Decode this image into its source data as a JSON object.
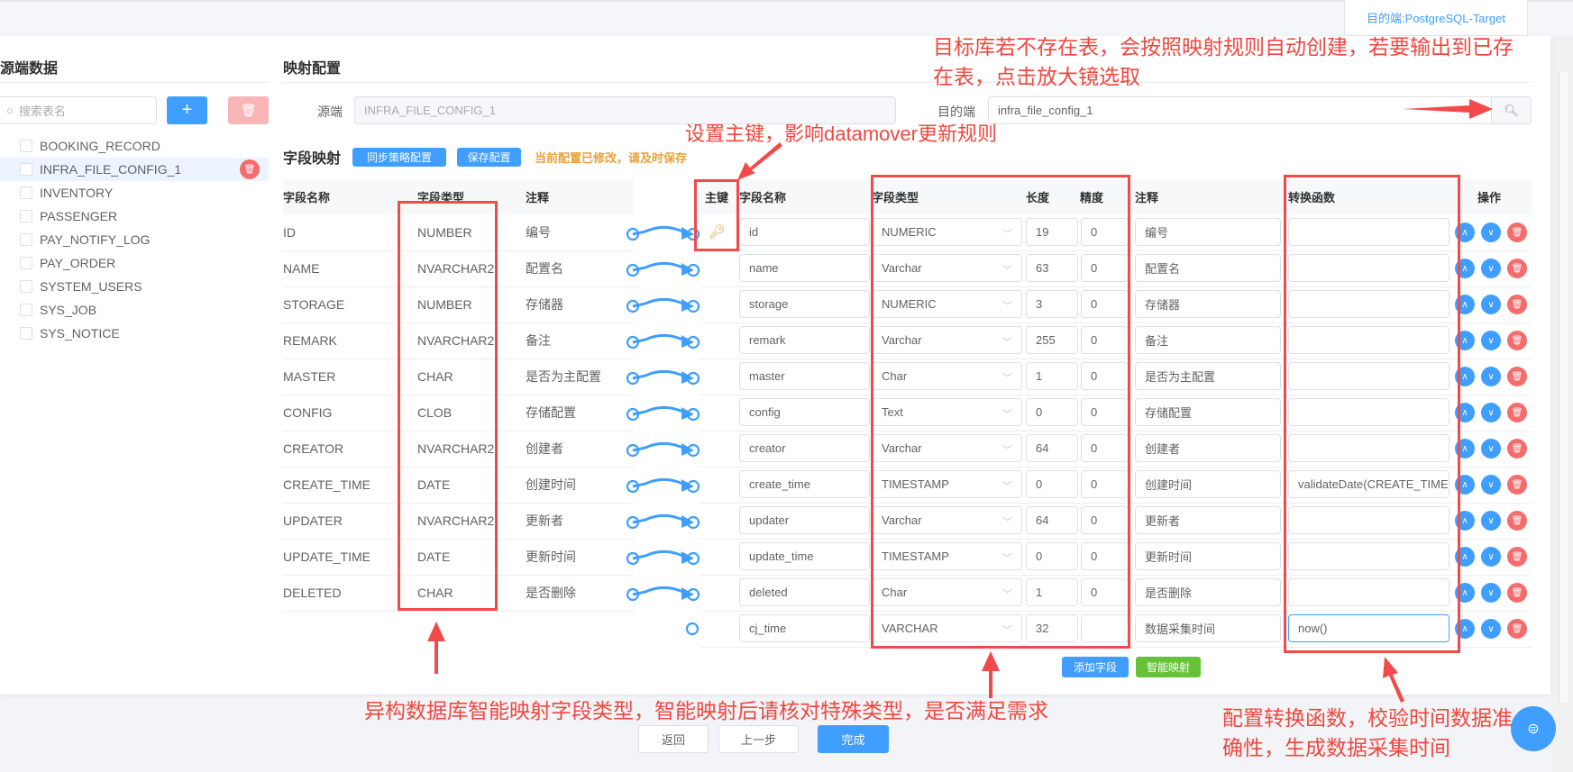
{
  "header": {
    "target_tab": "目的端:PostgreSQL-Target"
  },
  "left": {
    "title": "源端数据",
    "search_placeholder": "搜索表名",
    "add_icon": "plus-icon",
    "delete_icon": "trash-icon",
    "tables": [
      "BOOKING_RECORD",
      "INFRA_FILE_CONFIG_1",
      "INVENTORY",
      "PASSENGER",
      "PAY_NOTIFY_LOG",
      "PAY_ORDER",
      "SYSTEM_USERS",
      "SYS_JOB",
      "SYS_NOTICE"
    ],
    "selected": "INFRA_FILE_CONFIG_1"
  },
  "mapping": {
    "title": "映射配置",
    "source_label": "源端",
    "source_value": "INFRA_FILE_CONFIG_1",
    "target_label": "目的端",
    "target_value": "infra_file_config_1"
  },
  "fields": {
    "title": "字段映射",
    "sync_button": "同步策略配置",
    "save_button": "保存配置",
    "warning": "当前配置已修改，请及时保存",
    "source_headers": [
      "字段名称",
      "字段类型",
      "注释"
    ],
    "target_headers": [
      "主键",
      "字段名称",
      "字段类型",
      "长度",
      "精度",
      "注释",
      "转换函数",
      "操作"
    ],
    "source_rows": [
      [
        "ID",
        "NUMBER",
        "编号"
      ],
      [
        "NAME",
        "NVARCHAR2",
        "配置名"
      ],
      [
        "STORAGE",
        "NUMBER",
        "存储器"
      ],
      [
        "REMARK",
        "NVARCHAR2",
        "备注"
      ],
      [
        "MASTER",
        "CHAR",
        "是否为主配置"
      ],
      [
        "CONFIG",
        "CLOB",
        "存储配置"
      ],
      [
        "CREATOR",
        "NVARCHAR2",
        "创建者"
      ],
      [
        "CREATE_TIME",
        "DATE",
        "创建时间"
      ],
      [
        "UPDATER",
        "NVARCHAR2",
        "更新者"
      ],
      [
        "UPDATE_TIME",
        "DATE",
        "更新时间"
      ],
      [
        "DELETED",
        "CHAR",
        "是否删除"
      ]
    ],
    "target_rows": [
      {
        "pk": true,
        "name": "id",
        "type": "NUMERIC",
        "length": "19",
        "precision": "0",
        "comment": "编号",
        "func": ""
      },
      {
        "pk": false,
        "name": "name",
        "type": "Varchar",
        "length": "63",
        "precision": "0",
        "comment": "配置名",
        "func": ""
      },
      {
        "pk": false,
        "name": "storage",
        "type": "NUMERIC",
        "length": "3",
        "precision": "0",
        "comment": "存储器",
        "func": ""
      },
      {
        "pk": false,
        "name": "remark",
        "type": "Varchar",
        "length": "255",
        "precision": "0",
        "comment": "备注",
        "func": ""
      },
      {
        "pk": false,
        "name": "master",
        "type": "Char",
        "length": "1",
        "precision": "0",
        "comment": "是否为主配置",
        "func": ""
      },
      {
        "pk": false,
        "name": "config",
        "type": "Text",
        "length": "0",
        "precision": "0",
        "comment": "存储配置",
        "func": ""
      },
      {
        "pk": false,
        "name": "creator",
        "type": "Varchar",
        "length": "64",
        "precision": "0",
        "comment": "创建者",
        "func": ""
      },
      {
        "pk": false,
        "name": "create_time",
        "type": "TIMESTAMP",
        "length": "0",
        "precision": "0",
        "comment": "创建时间",
        "func": "validateDate(CREATE_TIME)"
      },
      {
        "pk": false,
        "name": "updater",
        "type": "Varchar",
        "length": "64",
        "precision": "0",
        "comment": "更新者",
        "func": ""
      },
      {
        "pk": false,
        "name": "update_time",
        "type": "TIMESTAMP",
        "length": "0",
        "precision": "0",
        "comment": "更新时间",
        "func": ""
      },
      {
        "pk": false,
        "name": "deleted",
        "type": "Char",
        "length": "1",
        "precision": "0",
        "comment": "是否删除",
        "func": ""
      },
      {
        "pk": false,
        "name": "cj_time",
        "type": "VARCHAR",
        "length": "32",
        "precision": "",
        "comment": "数据采集时间",
        "func": "now()"
      }
    ],
    "add_field": "添加字段",
    "smart_map": "智能映射"
  },
  "footer": {
    "back": "返回",
    "prev": "上一步",
    "finish": "完成"
  },
  "annotations": {
    "target_note": [
      "目标库若不存在表，会按照映射规则自动创建，若要输出到已存",
      "在表，点击放大镜选取"
    ],
    "pk_note": "设置主键，影响datamover更新规则",
    "type_note": "异构数据库智能映射字段类型，智能映射后请核对特殊类型，是否满足需求",
    "func_note": [
      "配置转换函数，校验时间数据准",
      "确性，生成数据采集时间"
    ]
  },
  "colors": {
    "primary": "#409eff",
    "danger": "#f56c6c",
    "success": "#67c23a",
    "warning": "#e6a23c",
    "annotation": "#f24a4a"
  }
}
